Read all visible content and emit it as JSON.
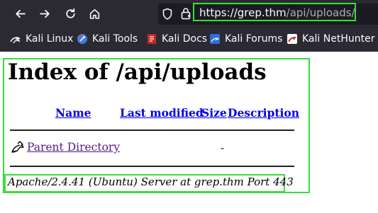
{
  "browser": {
    "url_host": "https://grep.thm",
    "url_path": "/api/uploads/",
    "bookmarks": [
      {
        "label": "Kali Linux",
        "icon": "kali-linux-icon"
      },
      {
        "label": "Kali Tools",
        "icon": "kali-tools-icon"
      },
      {
        "label": "Kali Docs",
        "icon": "kali-docs-icon"
      },
      {
        "label": "Kali Forums",
        "icon": "kali-forums-icon"
      },
      {
        "label": "Kali NetHunter",
        "icon": "kali-nethunter-icon"
      }
    ]
  },
  "page": {
    "title": "Index of /api/uploads",
    "columns": {
      "name": "Name",
      "last_modified": "Last modified",
      "size": "Size",
      "description": "Description"
    },
    "rows": [
      {
        "name": "Parent Directory",
        "size": "-",
        "icon": "back-folder-icon"
      }
    ],
    "footer": "Apache/2.4.41 (Ubuntu) Server at grep.thm Port 443"
  },
  "colors": {
    "chrome_bg": "#2b2a33",
    "urlbar_bg": "#1c1b22",
    "highlight_green": "#36e036",
    "link_blue": "#0000ee",
    "visited_purple": "#551a8b"
  }
}
